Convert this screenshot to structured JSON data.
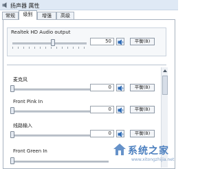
{
  "window": {
    "title": "扬声器 属性"
  },
  "tabs": [
    {
      "label": "常规"
    },
    {
      "label": "级别"
    },
    {
      "label": "增强"
    },
    {
      "label": "高级"
    }
  ],
  "output_device": {
    "name": "Realtek HD Audio output",
    "value": "50",
    "level": 0.5,
    "balance_label": "平衡(B)"
  },
  "inputs": [
    {
      "name": "麦克风",
      "value": "0",
      "level": 0,
      "balance_label": "平衡(B)"
    },
    {
      "name": "Front Pink In",
      "value": "0",
      "level": 0,
      "balance_label": "平衡(B)"
    },
    {
      "name": "线路输入",
      "value": "0",
      "level": 0,
      "balance_label": "平衡(B)"
    },
    {
      "name": "Front Green In",
      "value": "",
      "level": 0,
      "balance_label": ""
    }
  ],
  "watermark": {
    "text": "系统之家",
    "sub": "www.xitongzhijia.net"
  },
  "colors": {
    "accent": "#4b7fbf",
    "mute_icon": "#2e6bb5"
  }
}
